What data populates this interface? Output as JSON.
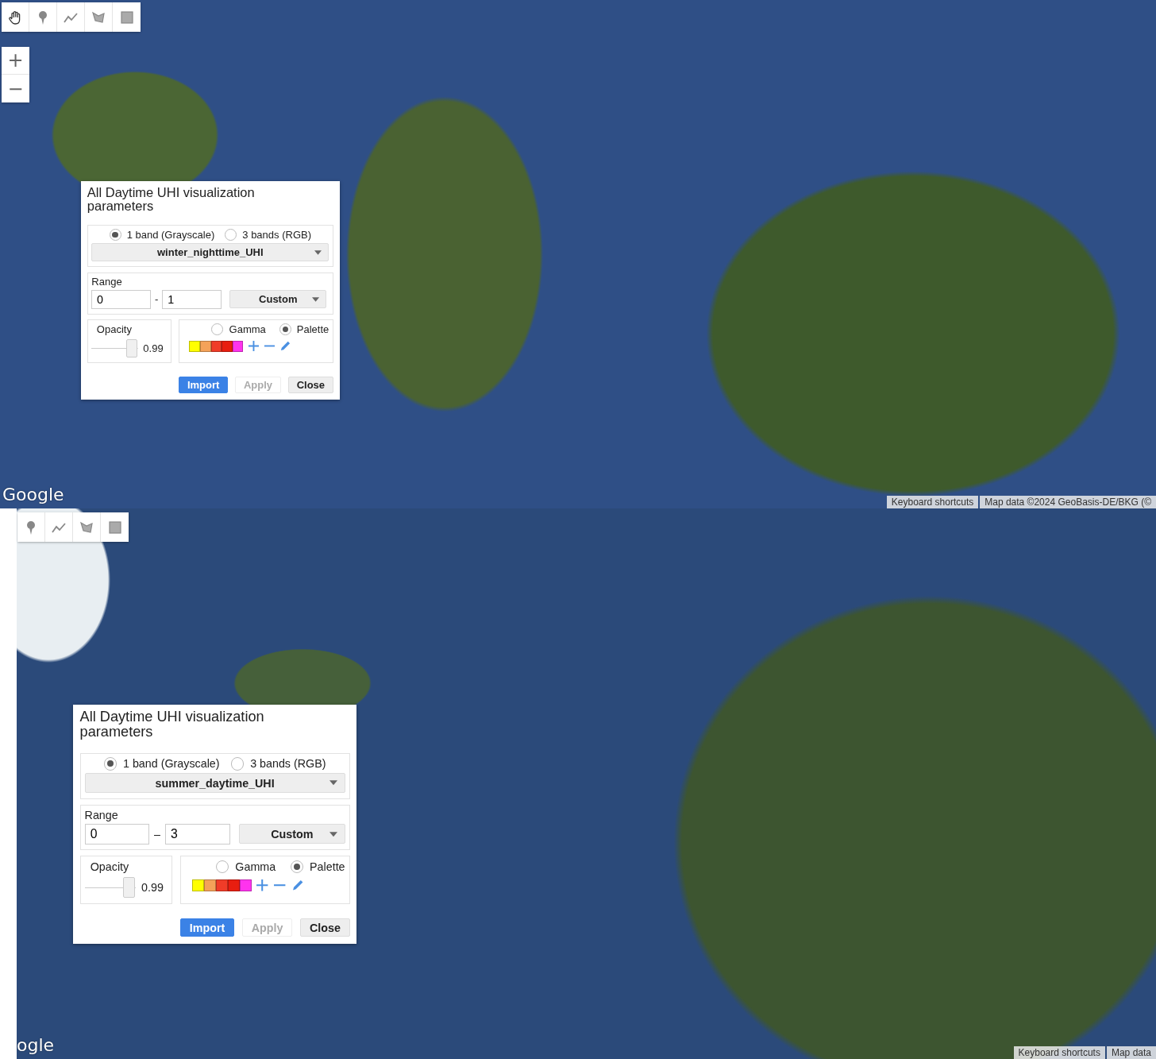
{
  "maps": [
    {
      "tools": [
        {
          "kind": "hand"
        },
        {
          "kind": "marker"
        },
        {
          "kind": "line"
        },
        {
          "kind": "polygon"
        },
        {
          "kind": "rectangle"
        }
      ],
      "zoom_controls": [
        "+",
        "−"
      ],
      "panel": {
        "title": "All Daytime UHI visualization parameters",
        "band_modes": [
          {
            "label": "1 band (Grayscale)",
            "selected": true
          },
          {
            "label": "3 bands (RGB)",
            "selected": false
          }
        ],
        "band": "winter_nighttime_UHI",
        "range": {
          "label": "Range",
          "min": "0",
          "separator": "-",
          "max": "1",
          "preset": "Custom"
        },
        "opacity": {
          "label": "Opacity",
          "level": 0.99,
          "reading": "0.99"
        },
        "modes": [
          {
            "label": "Gamma",
            "selected": false
          },
          {
            "label": "Palette",
            "selected": true
          }
        ],
        "palette": [
          {
            "color": "#ffff00"
          },
          {
            "color": "#f4a259"
          },
          {
            "color": "#f03c28"
          },
          {
            "color": "#e81e10"
          },
          {
            "color": "#ff33ee"
          }
        ],
        "buttons": [
          {
            "label": "Import",
            "kind": "primary",
            "disabled": false
          },
          {
            "label": "Apply",
            "kind": "normal",
            "disabled": true
          },
          {
            "label": "Close",
            "kind": "normal",
            "disabled": false
          }
        ]
      },
      "logo": "Google",
      "attribution": [
        "Keyboard shortcuts",
        "Map data ©2024 GeoBasis-DE/BKG (©"
      ]
    },
    {
      "tools": [
        {
          "kind": "marker"
        },
        {
          "kind": "line"
        },
        {
          "kind": "polygon"
        },
        {
          "kind": "rectangle"
        }
      ],
      "panel": {
        "title": "All Daytime UHI visualization parameters",
        "band_modes": [
          {
            "label": "1 band (Grayscale)",
            "selected": true
          },
          {
            "label": "3 bands (RGB)",
            "selected": false
          }
        ],
        "band": "summer_daytime_UHI",
        "range": {
          "label": "Range",
          "min": "0",
          "separator": "–",
          "max": "3",
          "preset": "Custom"
        },
        "opacity": {
          "label": "Opacity",
          "level": 0.99,
          "reading": "0.99"
        },
        "modes": [
          {
            "label": "Gamma",
            "selected": false
          },
          {
            "label": "Palette",
            "selected": true
          }
        ],
        "palette": [
          {
            "color": "#ffff00"
          },
          {
            "color": "#f4a259"
          },
          {
            "color": "#f03c28"
          },
          {
            "color": "#e81e10"
          },
          {
            "color": "#ff33ee"
          }
        ],
        "buttons": [
          {
            "label": "Import",
            "kind": "primary",
            "disabled": false
          },
          {
            "label": "Apply",
            "kind": "normal",
            "disabled": true
          },
          {
            "label": "Close",
            "kind": "normal",
            "disabled": false
          }
        ]
      },
      "logo": "ogle",
      "attribution": [
        "Keyboard shortcuts",
        "Map data"
      ]
    }
  ]
}
